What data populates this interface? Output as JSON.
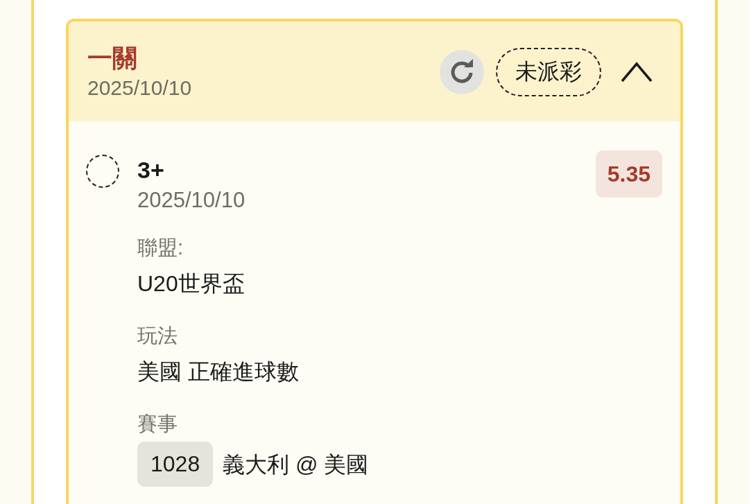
{
  "bet": {
    "title": "一關",
    "date": "2025/10/10",
    "status": "未派彩",
    "expanded": true
  },
  "selections": [
    {
      "selected": false,
      "pick": "3+",
      "date": "2025/10/10",
      "odds": "5.35",
      "fields": [
        {
          "kind": "text",
          "label": "聯盟:",
          "value": "U20世界盃"
        },
        {
          "kind": "text",
          "label": "玩法",
          "value": "美國 正確進球數"
        },
        {
          "kind": "match",
          "label": "賽事",
          "match_no": "1028",
          "value": "義大利 @ 美國"
        }
      ]
    }
  ]
}
